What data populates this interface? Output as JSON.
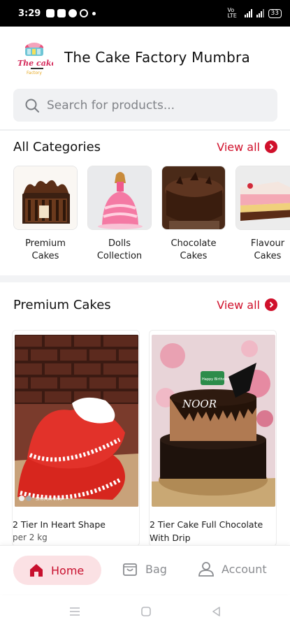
{
  "status_bar": {
    "time": "3:29",
    "network": "Vo LTE",
    "battery": "33"
  },
  "header": {
    "logo_text": "The cake",
    "logo_subtext": "Factory",
    "title": "The Cake Factory Mumbra"
  },
  "search": {
    "placeholder": "Search for products..."
  },
  "categories": {
    "title": "All Categories",
    "view_all": "View all",
    "items": [
      {
        "label": "Premium Cakes",
        "line1": "Premium",
        "line2": "Cakes"
      },
      {
        "label": "Dolls Collection",
        "line1": "Dolls",
        "line2": "Collection"
      },
      {
        "label": "Chocolate Cakes",
        "line1": "Chocolate",
        "line2": "Cakes"
      },
      {
        "label": "Flavour Cakes",
        "line1": "Flavour",
        "line2": "Cakes"
      }
    ]
  },
  "premium": {
    "title": "Premium Cakes",
    "view_all": "View all",
    "products": [
      {
        "name": "2 Tier In Heart Shape",
        "qty": "per 2 kg",
        "photo_caption": "Shot on Vivo"
      },
      {
        "name_line1": "2 Tier Cake Full Chocolate",
        "name_line2": "With Drip",
        "topper": "NOOR",
        "tag": "Happy Birthday"
      }
    ]
  },
  "bottom_nav": {
    "home": "Home",
    "bag": "Bag",
    "account": "Account"
  },
  "colors": {
    "accent": "#d0102b",
    "home_pill": "#fbe1e4",
    "search_bg": "#f0f1f3"
  }
}
